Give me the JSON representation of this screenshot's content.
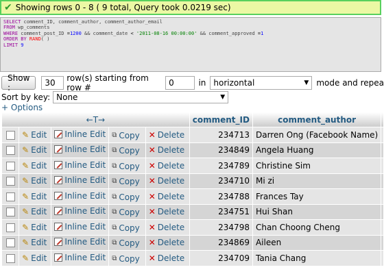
{
  "status": {
    "message": "Showing rows 0 - 8 ( 9 total, Query took 0.0219 sec)"
  },
  "sql": {
    "line1_kw": "SELECT",
    "line1_rest": " comment_ID, comment_author, comment_author_email",
    "line2_kw": "FROM",
    "line2_rest": " wp_comments",
    "line3_kw": "WHERE",
    "line3_a": " comment_post_ID ",
    "line3_eq": "=",
    "line3_num": "1200",
    "line3_and1": " && comment_date ",
    "line3_lt": "<",
    "line3_str": " '2011-08-16 00:00:00'",
    "line3_and2": " && comment_approved ",
    "line3_eq2": "=",
    "line3_num2": "1",
    "line4_kw": "ORDER BY",
    "line4_fn": " RAND",
    "line4_rest": "( )",
    "line5_kw": "LIMIT",
    "line5_num": " 9"
  },
  "nav": {
    "show_button": "Show :",
    "rows_value": "30",
    "rows_label": "row(s) starting from row #",
    "start_value": "0",
    "in_label": "in",
    "mode_value": "horizontal",
    "mode_label": "mode and repea"
  },
  "sort": {
    "label": "Sort by key:",
    "value": "None"
  },
  "options_link": "+ Options",
  "table": {
    "arrow_header": "←T→",
    "columns": [
      "comment_ID",
      "comment_author"
    ],
    "actions": {
      "edit": "Edit",
      "inline_edit": "Inline Edit",
      "copy": "Copy",
      "delete": "Delete"
    },
    "rows": [
      {
        "id": "234713",
        "author": "Darren Ong (Facebook Name)"
      },
      {
        "id": "234849",
        "author": "Angela Huang"
      },
      {
        "id": "234789",
        "author": "Christine Sim"
      },
      {
        "id": "234710",
        "author": "Mi zi"
      },
      {
        "id": "234788",
        "author": "Frances Tay"
      },
      {
        "id": "234751",
        "author": "Hui Shan"
      },
      {
        "id": "234798",
        "author": "Chan Choong Cheng"
      },
      {
        "id": "234869",
        "author": "Aileen"
      },
      {
        "id": "234709",
        "author": "Tania Chang"
      }
    ]
  },
  "colors": {
    "success_bg": "#ebf8a4",
    "success_border": "#58d05d",
    "link": "#235a81",
    "row_odd": "#e5e5e5",
    "row_even": "#d5d5d5"
  },
  "icons": {
    "status": "check-icon",
    "edit": "pencil-icon",
    "inline_edit": "inline-edit-icon",
    "copy": "copy-icon",
    "delete": "delete-x-icon"
  }
}
